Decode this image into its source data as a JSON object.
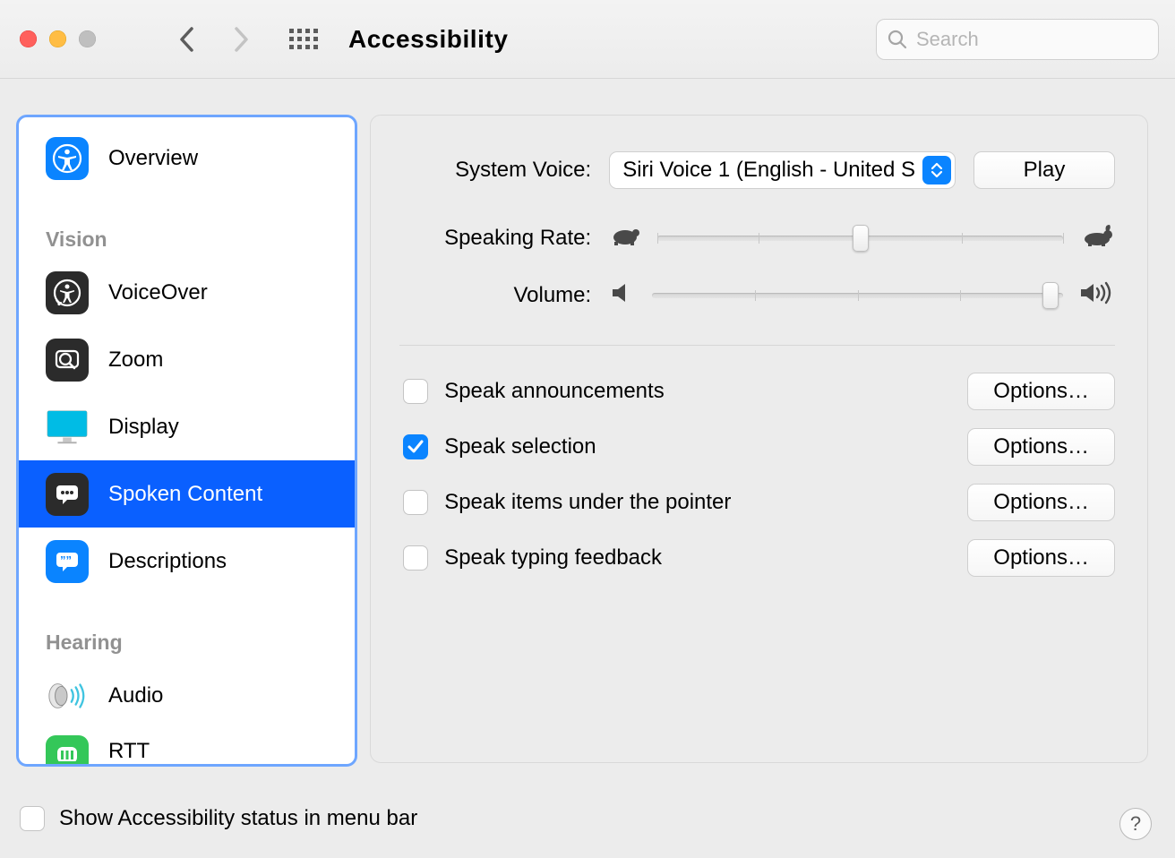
{
  "toolbar": {
    "title": "Accessibility",
    "search_placeholder": "Search"
  },
  "sidebar": {
    "overview_label": "Overview",
    "sections": [
      {
        "title": "Vision",
        "items": [
          {
            "label": "VoiceOver"
          },
          {
            "label": "Zoom"
          },
          {
            "label": "Display"
          },
          {
            "label": "Spoken Content",
            "selected": true
          },
          {
            "label": "Descriptions"
          }
        ]
      },
      {
        "title": "Hearing",
        "items": [
          {
            "label": "Audio"
          },
          {
            "label": "RTT"
          }
        ]
      }
    ]
  },
  "panel": {
    "system_voice_label": "System Voice:",
    "system_voice_value": "Siri Voice 1 (English - United S",
    "play_label": "Play",
    "speaking_rate_label": "Speaking Rate:",
    "speaking_rate_value": 50,
    "volume_label": "Volume:",
    "volume_value": 97,
    "checkboxes": [
      {
        "label": "Speak announcements",
        "checked": false,
        "options": "Options…"
      },
      {
        "label": "Speak selection",
        "checked": true,
        "options": "Options…"
      },
      {
        "label": "Speak items under the pointer",
        "checked": false,
        "options": "Options…"
      },
      {
        "label": "Speak typing feedback",
        "checked": false,
        "options": "Options…"
      }
    ]
  },
  "footer": {
    "status_checkbox_label": "Show Accessibility status in menu bar",
    "status_checked": false,
    "help_label": "?"
  }
}
